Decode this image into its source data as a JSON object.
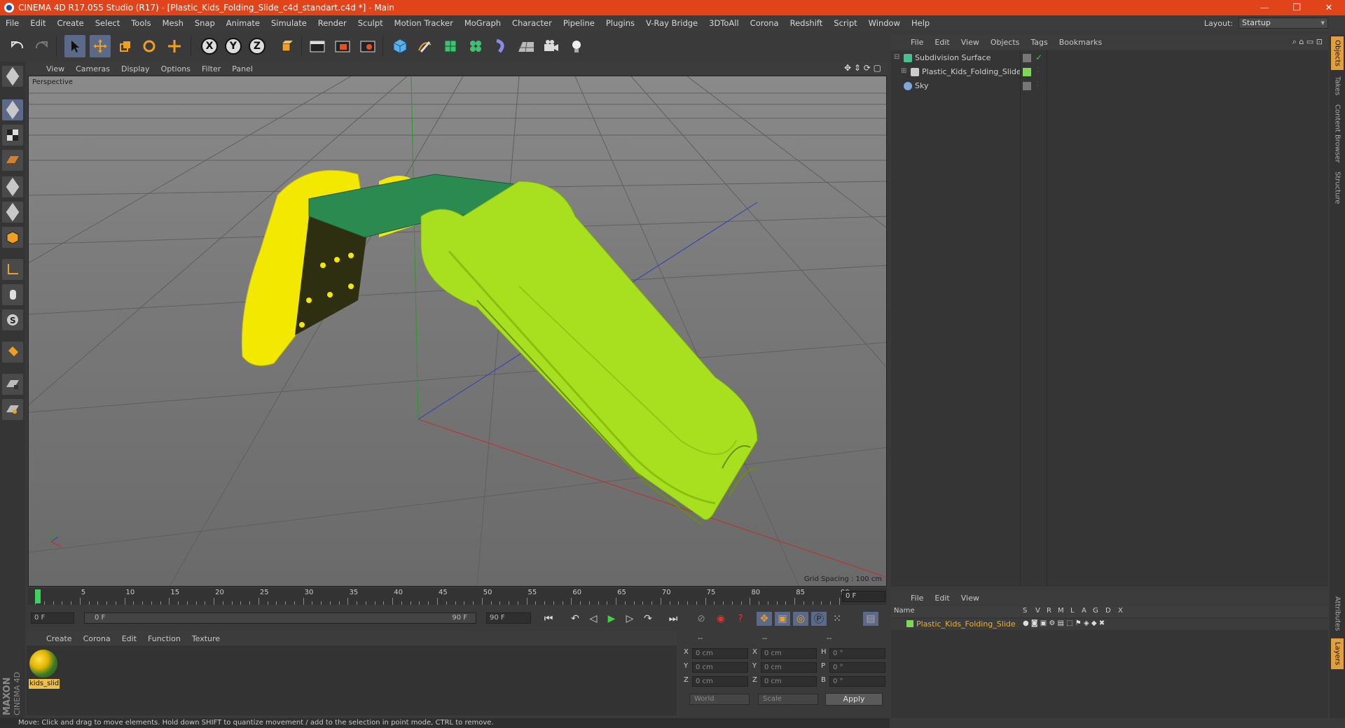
{
  "window": {
    "title": "CINEMA 4D R17.055 Studio (R17) - [Plastic_Kids_Folding_Slide_c4d_standart.c4d *] - Main",
    "buttons": [
      "—",
      "❐",
      "✕"
    ]
  },
  "menu": [
    "File",
    "Edit",
    "Create",
    "Select",
    "Tools",
    "Mesh",
    "Snap",
    "Animate",
    "Simulate",
    "Render",
    "Sculpt",
    "Motion Tracker",
    "MoGraph",
    "Character",
    "Pipeline",
    "Plugins",
    "V-Ray Bridge",
    "3DToAll",
    "Corona",
    "Redshift",
    "Script",
    "Window",
    "Help"
  ],
  "layout": {
    "label": "Layout:",
    "value": "Startup"
  },
  "toolbar": {
    "axes": [
      "X",
      "Y",
      "Z"
    ],
    "icons": [
      "undo-icon",
      "redo-icon",
      "select-arrow-icon",
      "move-icon",
      "scale-icon",
      "rotate-icon",
      "live-move-icon",
      "x-axis-icon",
      "y-axis-icon",
      "z-axis-icon",
      "coordinate-system-icon",
      "render-view-icon",
      "render-picture-viewer-icon",
      "render-settings-icon",
      "cube-primitive-icon",
      "pen-spline-icon",
      "subdivision-icon",
      "cloner-icon",
      "deformer-icon",
      "floor-icon",
      "camera-icon",
      "light-icon"
    ]
  },
  "viewport": {
    "menu": [
      "View",
      "Cameras",
      "Display",
      "Options",
      "Filter",
      "Panel"
    ],
    "camera_label": "Perspective",
    "grid_spacing": "Grid Spacing : 100 cm",
    "colors": {
      "slide_green": "#a8e020",
      "platform": "#2a8a50",
      "ladder_yellow": "#f2e800"
    }
  },
  "timeline": {
    "labels": [
      "0",
      "5",
      "10",
      "15",
      "20",
      "25",
      "30",
      "35",
      "40",
      "45",
      "50",
      "55",
      "60",
      "65",
      "70",
      "75",
      "80",
      "85",
      "90"
    ],
    "frame": "0 F"
  },
  "transport": {
    "start": "0 F",
    "range_start": "0 F",
    "range_end": "90 F",
    "end": "90 F"
  },
  "material_manager": {
    "menu": [
      "Create",
      "Corona",
      "Edit",
      "Function",
      "Texture"
    ],
    "materials": [
      {
        "name": "kids_slid"
      }
    ]
  },
  "coordinates": {
    "headers": [
      "--",
      "--",
      "--"
    ],
    "rows": [
      {
        "a": "X",
        "av": "0 cm",
        "b": "X",
        "bv": "0 cm",
        "c": "H",
        "cv": "0 °"
      },
      {
        "a": "Y",
        "av": "0 cm",
        "b": "Y",
        "bv": "0 cm",
        "c": "P",
        "cv": "0 °"
      },
      {
        "a": "Z",
        "av": "0 cm",
        "b": "Z",
        "bv": "0 cm",
        "c": "B",
        "cv": "0 °"
      }
    ],
    "mode_world": "World",
    "mode_scale": "Scale",
    "apply": "Apply"
  },
  "objects": {
    "menu": [
      "File",
      "Edit",
      "View",
      "Objects",
      "Tags",
      "Bookmarks"
    ],
    "items": [
      {
        "name": "Subdivision Surface",
        "icon_color": "#4ac090"
      },
      {
        "name": "Plastic_Kids_Folding_Slide",
        "icon_color": "#cccccc",
        "tag_color": "#7ed957"
      },
      {
        "name": "Sky",
        "icon_color": "#7fa8d8"
      }
    ]
  },
  "layers": {
    "menu": [
      "File",
      "Edit",
      "View"
    ],
    "columns": [
      "Name",
      "S",
      "V",
      "R",
      "M",
      "L",
      "A",
      "G",
      "D",
      "X"
    ],
    "rows": [
      {
        "name": "Plastic_Kids_Folding_Slide",
        "color": "#7ed957"
      }
    ]
  },
  "right_tabs": [
    "Objects",
    "Takes",
    "Content Browser",
    "Structure",
    "Attributes",
    "Layers"
  ],
  "status": "Move: Click and drag to move elements. Hold down SHIFT to quantize movement / add to the selection in point mode, CTRL to remove.",
  "brand": {
    "line1": "MAXON",
    "line2": "CINEMA 4D"
  }
}
